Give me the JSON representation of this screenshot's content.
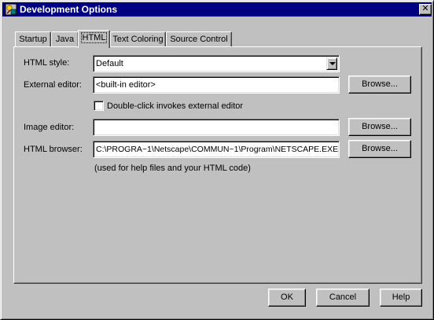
{
  "window": {
    "title": "Development Options",
    "icon": "app-icon",
    "close_label": "✕"
  },
  "tabs": [
    {
      "label": "Startup",
      "active": false
    },
    {
      "label": "Java",
      "active": false
    },
    {
      "label": "HTML",
      "active": true
    },
    {
      "label": "Text Coloring",
      "active": false
    },
    {
      "label": "Source Control",
      "active": false
    }
  ],
  "html_tab": {
    "html_style": {
      "label": "HTML style:",
      "value": "Default"
    },
    "external_editor": {
      "label": "External editor:",
      "value": "<built-in editor>",
      "browse_label": "Browse..."
    },
    "double_click": {
      "label": "Double-click invokes external editor",
      "checked": false
    },
    "image_editor": {
      "label": "Image editor:",
      "value": "",
      "browse_label": "Browse..."
    },
    "html_browser": {
      "label": "HTML browser:",
      "value": "C:\\PROGRA~1\\Netscape\\COMMUN~1\\Program\\NETSCAPE.EXE",
      "browse_label": "Browse..."
    },
    "browser_note": "(used for help files and your HTML code)"
  },
  "footer": {
    "ok_label": "OK",
    "cancel_label": "Cancel",
    "help_label": "Help"
  }
}
